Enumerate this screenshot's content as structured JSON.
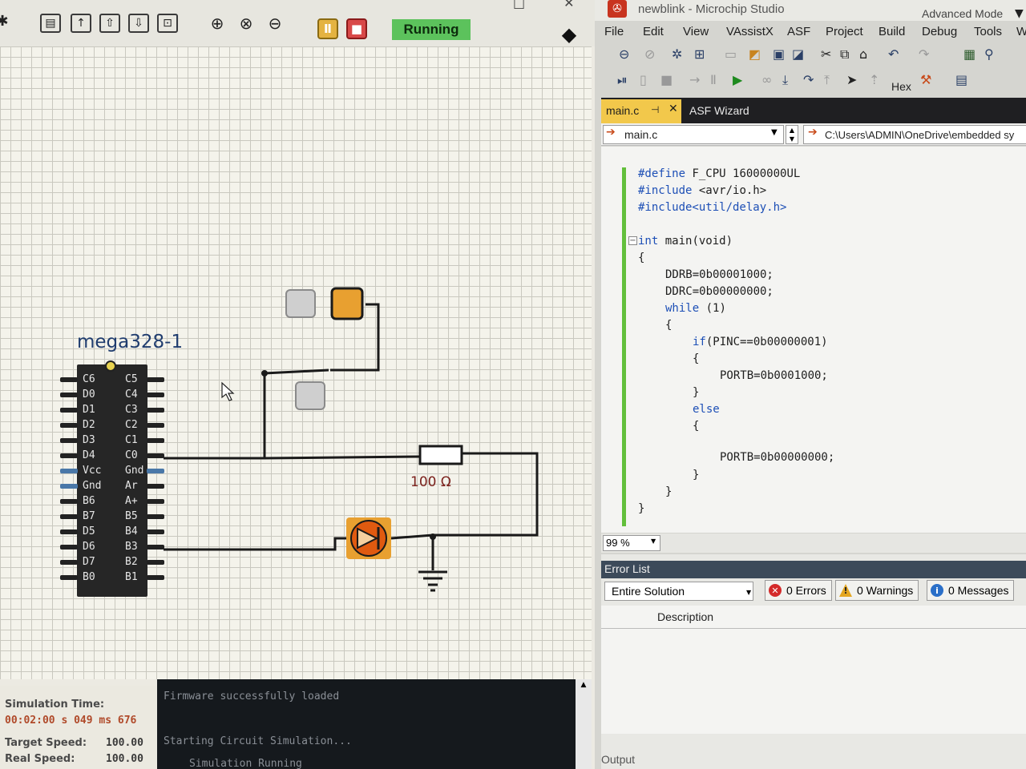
{
  "simulator": {
    "status_button": "Running",
    "toolbar_icons": [
      "settings-icon",
      "board-icon",
      "upload-icon",
      "download-icon",
      "export-icon",
      "save-icon",
      "zoom-in-icon",
      "zoom-fit-icon",
      "zoom-out-icon",
      "pause-icon",
      "stop-icon",
      "run-indicator",
      "cursor-icon"
    ],
    "chip": {
      "title": "mega328-1",
      "left_pins": [
        "C6",
        "D0",
        "D1",
        "D2",
        "D3",
        "D4",
        "Vcc",
        "Gnd",
        "B6",
        "B7",
        "D5",
        "D6",
        "D7",
        "B0"
      ],
      "right_pins": [
        "C5",
        "C4",
        "C3",
        "C2",
        "C1",
        "C0",
        "Gnd",
        "Ar",
        "A+",
        "B5",
        "B4",
        "B3",
        "B2",
        "B1"
      ]
    },
    "resistor_label": "100 Ω",
    "status": {
      "sim_time_label": "Simulation Time:",
      "sim_time_value": "00:02:00 s  049 ms  676",
      "target_speed_label": "Target Speed:",
      "target_speed_value": "100.00",
      "real_speed_label": "Real Speed:",
      "real_speed_value": "100.00"
    },
    "console": [
      "Firmware successfully loaded",
      "Starting Circuit Simulation...",
      "Simulation Running"
    ]
  },
  "ide": {
    "title": "newblink - Microchip Studio",
    "mode": "Advanced Mode",
    "menu": [
      "File",
      "Edit",
      "View",
      "VAssistX",
      "ASF",
      "Project",
      "Build",
      "Debug",
      "Tools",
      "W"
    ],
    "hex_label": "Hex",
    "tabs": {
      "active": "main.c",
      "other": "ASF Wizard"
    },
    "nav": {
      "file": "main.c",
      "path": "C:\\Users\\ADMIN\\OneDrive\\embedded sy"
    },
    "code": [
      {
        "text": "#define F_CPU 16000000UL",
        "kw": "#define"
      },
      {
        "text": "#include <avr/io.h>",
        "kw": "#include"
      },
      {
        "text": "#include<util/delay.h>",
        "kw": "#include<util/delay.h>"
      },
      {
        "text": "int main(void)",
        "kw": "int"
      },
      {
        "text": "{",
        "kw": ""
      },
      {
        "text": "DDRB=0b00001000;",
        "kw": ""
      },
      {
        "text": "DDRC=0b00000000;",
        "kw": ""
      },
      {
        "text": "while (1)",
        "kw": "while"
      },
      {
        "text": "{",
        "kw": ""
      },
      {
        "text": "if(PINC==0b00000001)",
        "kw": "if"
      },
      {
        "text": "{",
        "kw": ""
      },
      {
        "text": "PORTB=0b0001000;",
        "kw": ""
      },
      {
        "text": "}",
        "kw": ""
      },
      {
        "text": "else",
        "kw": "else"
      },
      {
        "text": "{",
        "kw": ""
      },
      {
        "text": "PORTB=0b00000000;",
        "kw": ""
      },
      {
        "text": "}",
        "kw": ""
      },
      {
        "text": "}",
        "kw": ""
      },
      {
        "text": "}",
        "kw": ""
      }
    ],
    "zoom": "99 %",
    "error_list": {
      "header": "Error List",
      "scope": "Entire Solution",
      "errors": "0 Errors",
      "warnings": "0 Warnings",
      "messages": "0 Messages",
      "column": "Description"
    },
    "output_label": "Output"
  },
  "colors": {
    "running": "#5cc25c",
    "led_orange": "#e8a030",
    "console_bg": "#15191d",
    "gutter_green": "#62bf3b",
    "active_tab": "#f2c84b",
    "keyword": "#1d4fb6"
  }
}
